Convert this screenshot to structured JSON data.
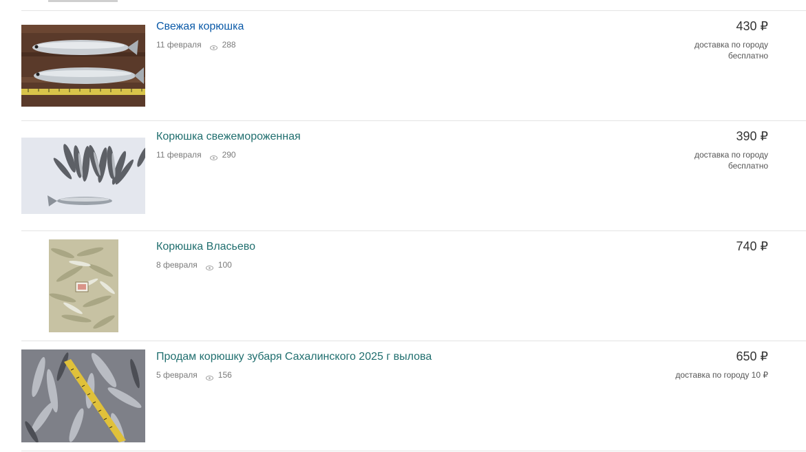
{
  "listings": [
    {
      "title": "Свежая корюшка",
      "date": "11 февраля",
      "views": "288",
      "price": "430 ₽",
      "delivery_line1": "доставка по городу",
      "delivery_line2": "бесплатно",
      "icon": "eye-icon"
    },
    {
      "title": "Корюшка свежемороженная",
      "date": "11 февраля",
      "views": "290",
      "price": "390 ₽",
      "delivery_line1": "доставка по городу",
      "delivery_line2": "бесплатно",
      "icon": "eye-icon"
    },
    {
      "title": "Корюшка Власьево",
      "date": "8 февраля",
      "views": "100",
      "price": "740 ₽",
      "icon": "eye-icon"
    },
    {
      "title": "Продам корюшку зубаря Сахалинского 2025 г вылова",
      "date": "5 февраля",
      "views": "156",
      "price": "650 ₽",
      "delivery_line1": "доставка по городу 10 ₽",
      "icon": "eye-icon"
    }
  ],
  "colors": {
    "link": "#0b5aa8",
    "visited_link": "#1f6e6e",
    "meta_text": "#7a7a7a",
    "price_text": "#333333",
    "divider": "#e3e3e3"
  }
}
